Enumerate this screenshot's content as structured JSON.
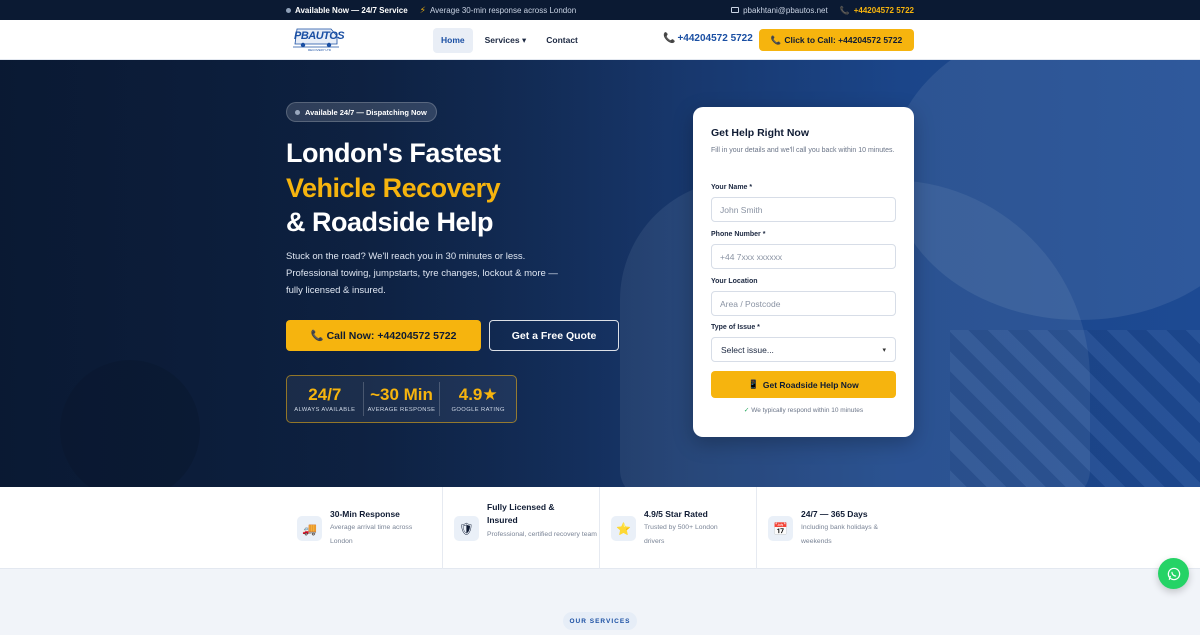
{
  "topbar": {
    "availability": "Available Now — 24/7 Service",
    "response": "Average 30-min response across London",
    "email": "pbakhtani@pbautos.net",
    "phone": "+44204572 5722"
  },
  "nav": {
    "logo_text": "PBAUTOS",
    "logo_sub": "RECOVERY LTD",
    "items": [
      {
        "label": "Home",
        "active": true
      },
      {
        "label": "Services ▾",
        "active": false
      },
      {
        "label": "Contact",
        "active": false
      }
    ],
    "phone": "+44204572 5722",
    "cta_label": "Click to Call: +44204572 5722"
  },
  "hero": {
    "badge": "Available 24/7 — Dispatching Now",
    "title_line1": "London's Fastest",
    "title_line2": "Vehicle Recovery",
    "title_line3": "& Roadside Help",
    "lead": "Stuck on the road? We'll reach you in 30 minutes or less. Professional towing, jumpstarts, tyre changes, lockout & more — fully licensed & insured.",
    "call_button": "Call Now: +44204572 5722",
    "quote_button": "Get a Free Quote",
    "stats": [
      {
        "value": "24/7",
        "label": "ALWAYS AVAILABLE"
      },
      {
        "value": "~30 Min",
        "label": "AVERAGE RESPONSE"
      },
      {
        "value": "4.9★",
        "label": "GOOGLE RATING"
      }
    ]
  },
  "form": {
    "title": "Get Help Right Now",
    "subtitle": "Fill in your details and we'll call you back within 10 minutes.",
    "name_label": "Your Name *",
    "name_placeholder": "John Smith",
    "phone_label": "Phone Number *",
    "phone_placeholder": "+44 7xxx xxxxxx",
    "location_label": "Your Location",
    "location_placeholder": "Area / Postcode",
    "issue_label": "Type of Issue *",
    "issue_selected": "Select issue...",
    "submit": "Get Roadside Help Now",
    "note": "We typically respond within 10 minutes"
  },
  "features": [
    {
      "icon": "tow-truck-icon",
      "title": "30-Min Response",
      "desc": "Average arrival time across London"
    },
    {
      "icon": "shield-icon",
      "title": "Fully Licensed & Insured",
      "desc": "Professional, certified recovery team"
    },
    {
      "icon": "star-icon",
      "title": "4.9/5 Star Rated",
      "desc": "Trusted by 500+ London drivers"
    },
    {
      "icon": "calendar-icon",
      "title": "24/7 — 365 Days",
      "desc": "Including bank holidays & weekends"
    }
  ],
  "section_tag": "OUR SERVICES",
  "colors": {
    "accent": "#f6b40e",
    "brand": "#1a4fa3",
    "topbar": "#0b1a33",
    "whatsapp": "#25d366"
  }
}
